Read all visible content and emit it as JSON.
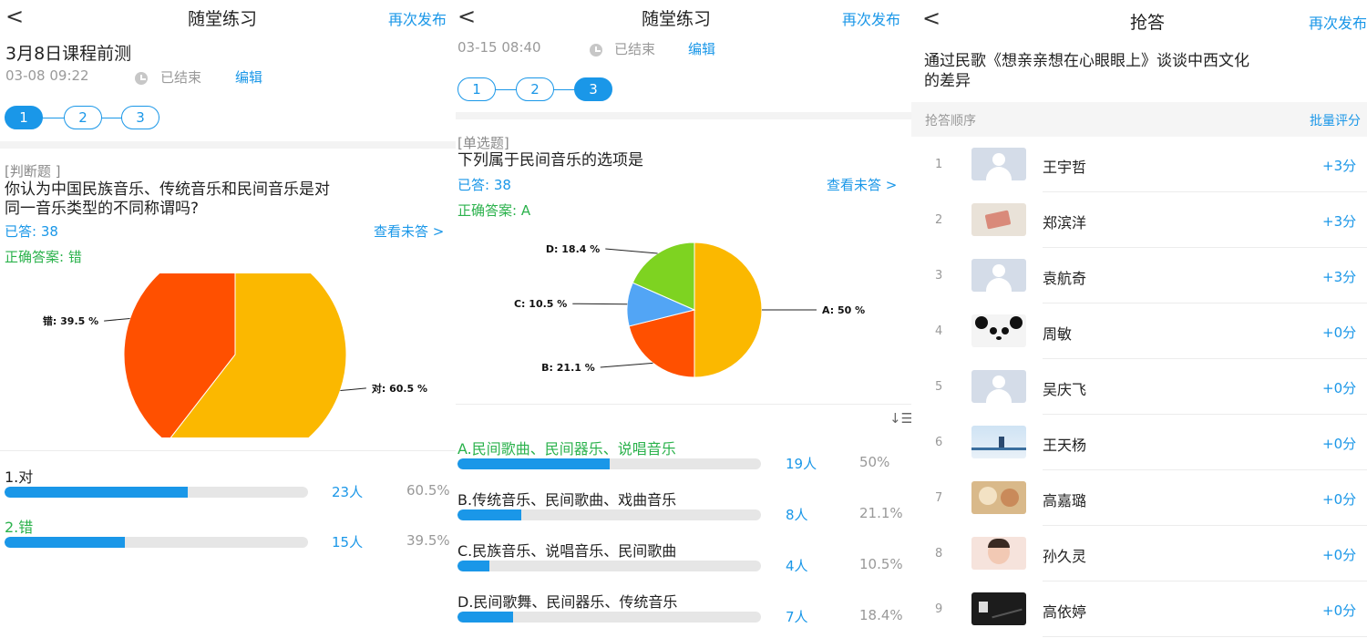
{
  "panel1": {
    "back": "<",
    "title": "随堂练习",
    "action": "再次发布",
    "quiz_title": "3月8日课程前测",
    "time": "03-08 09:22",
    "status": "已结束",
    "edit": "编辑",
    "steps": [
      "1",
      "2",
      "3"
    ],
    "active_step": 0,
    "question_type": "[判断题 ]",
    "question_line1": "你认为中国民族音乐、传统音乐和民间音乐是对",
    "question_line2": "同一音乐类型的不同称谓吗?",
    "answered": "已答: 38",
    "view_unanswered": "查看未答 >",
    "correct_answer": "正确答案: 错",
    "chart_data": {
      "type": "pie",
      "labels": [
        "对",
        "错"
      ],
      "values": [
        60.5,
        39.5
      ],
      "label_texts": [
        "对: 60.5 %",
        "错: 39.5 %"
      ],
      "colors": [
        "#fbb800",
        "#ff5000"
      ]
    },
    "options": [
      {
        "label": "1.对",
        "count": "23人",
        "pct": "60.5%",
        "fraction": 0.605,
        "correct": false
      },
      {
        "label": "2.错",
        "count": "15人",
        "pct": "39.5%",
        "fraction": 0.395,
        "correct": true
      }
    ]
  },
  "panel2": {
    "back": "<",
    "title": "随堂练习",
    "action": "再次发布",
    "time": "03-15 08:40",
    "status": "已结束",
    "edit": "编辑",
    "steps": [
      "1",
      "2",
      "3"
    ],
    "active_step": 2,
    "question_type": "[单选题]",
    "question_line1": "下列属于民间音乐的选项是",
    "answered": "已答: 38",
    "view_unanswered": "查看未答 >",
    "correct_answer": "正确答案: A",
    "chart_data": {
      "type": "pie",
      "labels": [
        "A",
        "B",
        "C",
        "D"
      ],
      "values": [
        50,
        21.1,
        10.5,
        18.4
      ],
      "label_texts": [
        "A: 50 %",
        "B: 21.1 %",
        "C: 10.5 %",
        "D: 18.4 %"
      ],
      "colors": [
        "#fbb800",
        "#ff5000",
        "#52a5f5",
        "#7ed321"
      ]
    },
    "sort_icon": "sort-icon",
    "options": [
      {
        "label": "A.民间歌曲、民间器乐、说唱音乐",
        "count": "19人",
        "pct": "50%",
        "fraction": 0.5,
        "correct": true
      },
      {
        "label": "B.传统音乐、民间歌曲、戏曲音乐",
        "count": "8人",
        "pct": "21.1%",
        "fraction": 0.211,
        "correct": false
      },
      {
        "label": "C.民族音乐、说唱音乐、民间歌曲",
        "count": "4人",
        "pct": "10.5%",
        "fraction": 0.105,
        "correct": false
      },
      {
        "label": "D.民间歌舞、民间器乐、传统音乐",
        "count": "7人",
        "pct": "18.4%",
        "fraction": 0.184,
        "correct": false
      }
    ]
  },
  "panel3": {
    "back": "<",
    "title": "抢答",
    "action": "再次发布",
    "question_line1": "通过民歌《想亲亲想在心眼眼上》谈谈中西文化",
    "question_line2": "的差异",
    "order_label": "抢答顺序",
    "batch_label": "批量评分",
    "rows": [
      {
        "rank": "1",
        "name": "王宇哲",
        "score": "+3分",
        "avatar": "default-avatar"
      },
      {
        "rank": "2",
        "name": "郑滨洋",
        "score": "+3分",
        "avatar": "photo-avatar"
      },
      {
        "rank": "3",
        "name": "袁航奇",
        "score": "+3分",
        "avatar": "default-avatar"
      },
      {
        "rank": "4",
        "name": "周敏",
        "score": "+0分",
        "avatar": "panda-avatar"
      },
      {
        "rank": "5",
        "name": "吴庆飞",
        "score": "+0分",
        "avatar": "default-avatar"
      },
      {
        "rank": "6",
        "name": "王天杨",
        "score": "+0分",
        "avatar": "beach-avatar"
      },
      {
        "rank": "7",
        "name": "高嘉璐",
        "score": "+0分",
        "avatar": "bear-avatar"
      },
      {
        "rank": "8",
        "name": "孙久灵",
        "score": "+0分",
        "avatar": "child-avatar"
      },
      {
        "rank": "9",
        "name": "高依婷",
        "score": "+0分",
        "avatar": "dark-avatar"
      }
    ]
  }
}
